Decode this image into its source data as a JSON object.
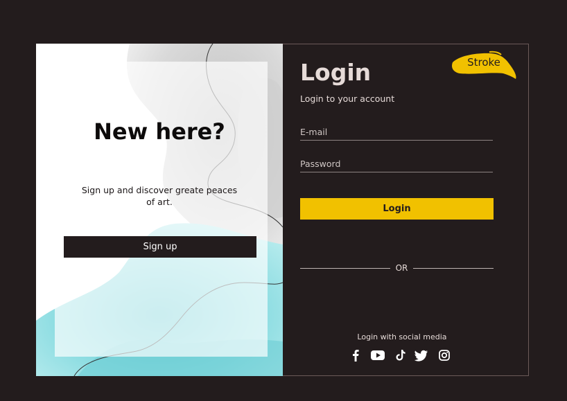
{
  "signup_panel": {
    "heading": "New here?",
    "tagline": "Sign up and discover greate peaces of art.",
    "signup_label": "Sign up"
  },
  "login_panel": {
    "title": "Login",
    "subtitle": "Login to your account",
    "email_placeholder": "E-mail",
    "password_placeholder": "Password",
    "login_label": "Login",
    "divider_text": "OR",
    "social_label": "Login with social media",
    "badge_text": "Stroke",
    "social_icons": [
      "facebook-icon",
      "youtube-icon",
      "tiktok-icon",
      "twitter-icon",
      "instagram-icon"
    ]
  },
  "colors": {
    "background": "#231c1d",
    "accent": "#f1c100",
    "text_light": "#e6dbd8",
    "watercolor": "#7fd7dc"
  }
}
